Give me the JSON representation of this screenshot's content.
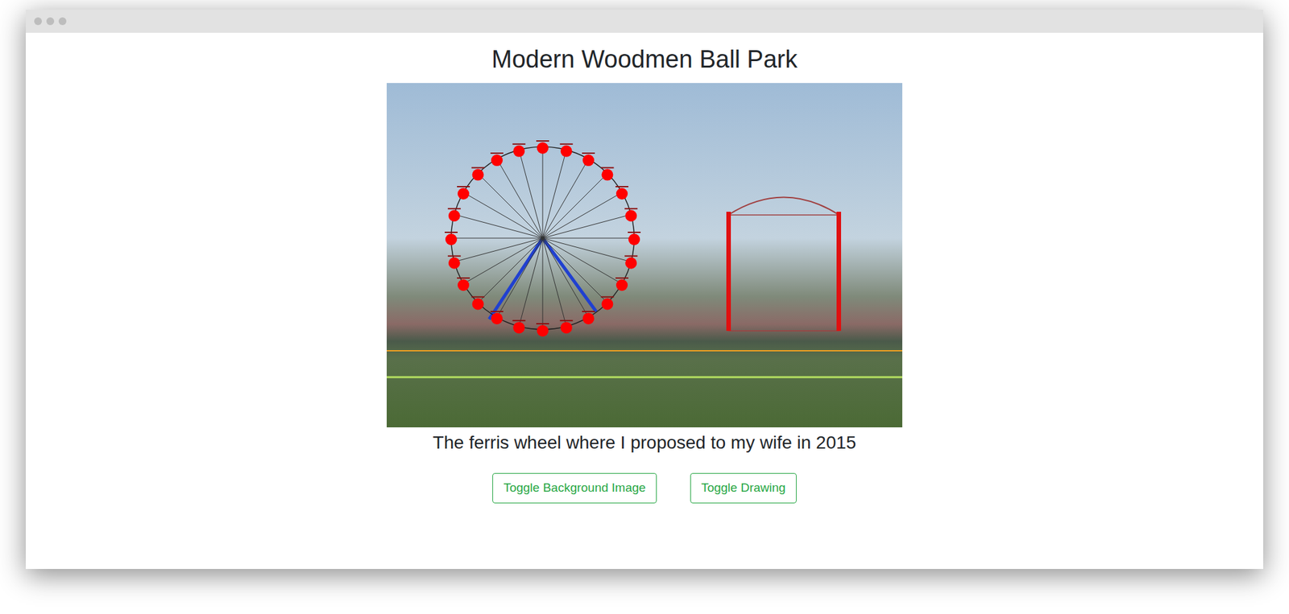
{
  "page": {
    "heading": "Modern Woodmen Ball Park",
    "caption": "The ferris wheel where I proposed to my wife in 2015"
  },
  "image": {
    "background_visible": true,
    "drawing_visible": true
  },
  "buttons": [
    {
      "label": "Toggle Background Image"
    },
    {
      "label": "Toggle Drawing"
    }
  ]
}
